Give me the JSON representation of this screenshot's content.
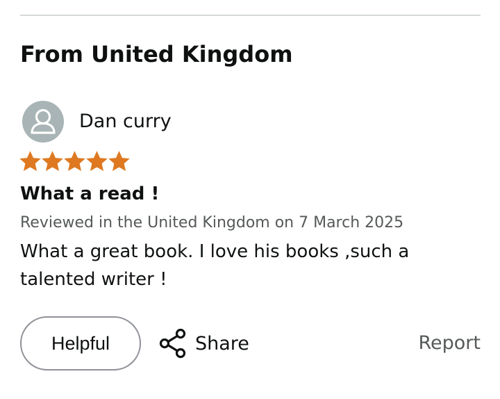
{
  "section": {
    "title": "From United Kingdom"
  },
  "review": {
    "reviewer_name": "Dan curry",
    "rating": 5,
    "rating_max": 5,
    "title": "What a read !",
    "meta": "Reviewed in the United Kingdom on 7 March 2025",
    "body": "What a great book. I love his books ,such a talented writer !"
  },
  "actions": {
    "helpful_label": "Helpful",
    "share_label": "Share",
    "report_label": "Report"
  },
  "icons": {
    "avatar": "user-avatar-icon",
    "star": "star-icon",
    "share": "share-icon"
  },
  "colors": {
    "star": "#de7921",
    "avatar_bg": "#a8b4b5",
    "text_primary": "#0f1111",
    "text_secondary": "#565959",
    "divider": "#d5d9d9",
    "button_border": "#8d9096"
  }
}
